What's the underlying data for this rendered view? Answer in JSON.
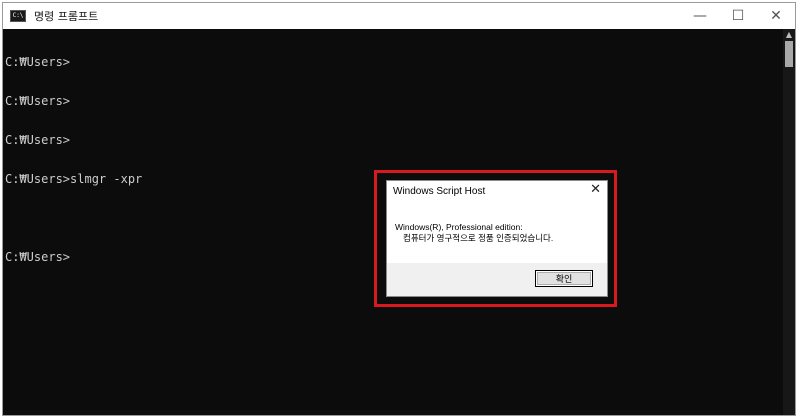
{
  "window": {
    "title": "명령 프롬프트",
    "icon_text": "C:\\",
    "controls": {
      "minimize": "—",
      "maximize": "☐",
      "close": "✕"
    }
  },
  "console": {
    "lines": [
      "C:₩Users>",
      "C:₩Users>",
      "C:₩Users>",
      "C:₩Users>slmgr -xpr",
      "",
      "C:₩Users>"
    ]
  },
  "dialog": {
    "title": "Windows Script Host",
    "close": "✕",
    "message_line1": "Windows(R), Professional edition:",
    "message_line2": "컴퓨터가 영구적으로 정품 인증되었습니다.",
    "ok_label": "확인"
  },
  "colors": {
    "console_bg": "#0c0c0c",
    "console_text": "#cccccc",
    "highlight": "#d81a20"
  }
}
